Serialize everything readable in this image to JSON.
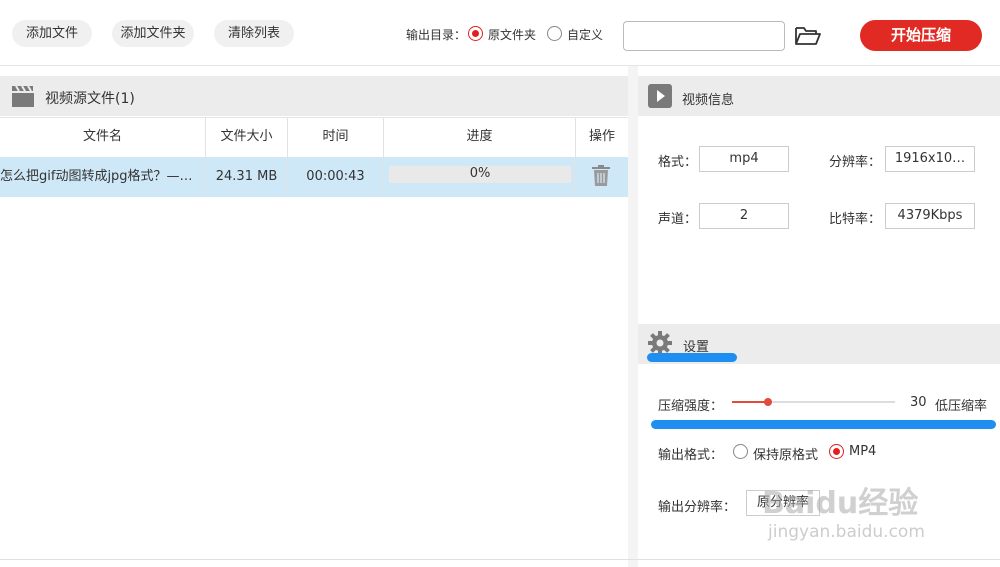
{
  "toolbar": {
    "add_file": "添加文件",
    "add_folder": "添加文件夹",
    "clear_list": "清除列表",
    "output_dir_label": "输出目录：",
    "option_original": "原文件夹",
    "option_custom": "自定义",
    "path_value": "",
    "start_label": "开始压缩"
  },
  "source_panel": {
    "title": "视频源文件(1)",
    "columns": [
      "文件名",
      "文件大小",
      "时间",
      "进度",
      "操作"
    ],
    "rows": [
      {
        "name": "怎么把gif动图转成jpg格式？—…",
        "size": "24.31 MB",
        "duration": "00:00:43",
        "progress": 0,
        "progress_label": "0%"
      }
    ]
  },
  "video_info": {
    "title": "视频信息",
    "format_label": "格式：",
    "format_value": "mp4",
    "resolution_label": "分辨率：",
    "resolution_value": "1916x10…",
    "channel_label": "声道：",
    "channel_value": "2",
    "bitrate_label": "比特率：",
    "bitrate_value": "4379Kbps"
  },
  "settings": {
    "title": "设置",
    "strength_label": "压缩强度：",
    "strength_value": "30",
    "strength_fraction": 0.22,
    "strength_desc": "低压缩率",
    "format_label": "输出格式：",
    "format_opt_keep": "保持原格式",
    "format_opt_mp4": "MP4",
    "resolution_label": "输出分辨率：",
    "resolution_value": "原分辨率"
  },
  "watermark": {
    "text": "Baidu经验",
    "url": "jingyan.baidu.com"
  },
  "colors": {
    "accent_red": "#e02a23",
    "highlight_blue": "#1e8ff0",
    "row_selected": "#cfe8f7"
  }
}
